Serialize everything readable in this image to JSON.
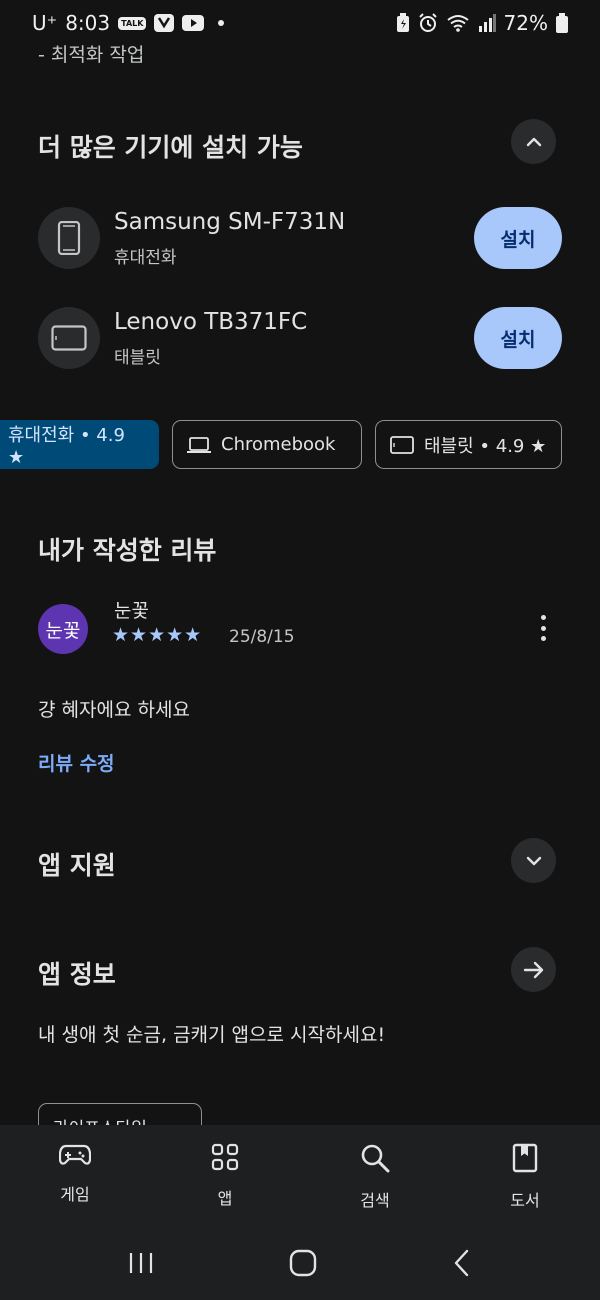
{
  "status_bar": {
    "carrier": "U⁺",
    "time": "8:03",
    "badge_talk": "TALK",
    "battery": "72%"
  },
  "top_text": "- 최적화 작업",
  "install_section": {
    "title": "더 많은 기기에 설치 가능",
    "devices": [
      {
        "name": "Samsung SM-F731N",
        "type": "휴대전화",
        "button": "설치",
        "icon": "phone-icon"
      },
      {
        "name": "Lenovo TB371FC",
        "type": "태블릿",
        "button": "설치",
        "icon": "tablet-icon"
      }
    ]
  },
  "filter_chips": [
    {
      "label": "휴대전화 • 4.9 ★",
      "active": true
    },
    {
      "label": "Chromebook",
      "icon": "laptop-icon",
      "active": false
    },
    {
      "label": "태블릿 • 4.9 ★",
      "icon": "tablet-icon",
      "active": false
    }
  ],
  "my_review": {
    "title": "내가 작성한 리뷰",
    "avatar_text": "눈꽃",
    "author": "눈꽃",
    "rating": 5,
    "stars": "★★★★★",
    "date": "25/8/15",
    "body": "걍 혜자에요 하세요",
    "edit_label": "리뷰 수정"
  },
  "app_support": {
    "title": "앱 지원"
  },
  "app_info": {
    "title": "앱 정보",
    "description": "내 생애 첫 순금, 금캐기 앱으로 시작하세요!",
    "partial_chip": "라이프스타일"
  },
  "bottom_nav": [
    {
      "label": "게임",
      "icon": "gamepad-icon"
    },
    {
      "label": "앱",
      "icon": "apps-grid-icon"
    },
    {
      "label": "검색",
      "icon": "search-icon"
    },
    {
      "label": "도서",
      "icon": "book-icon"
    }
  ],
  "colors": {
    "background": "#131314",
    "accent": "#a8c7fa",
    "active_chip": "#004a77",
    "avatar": "#5e35b1"
  }
}
